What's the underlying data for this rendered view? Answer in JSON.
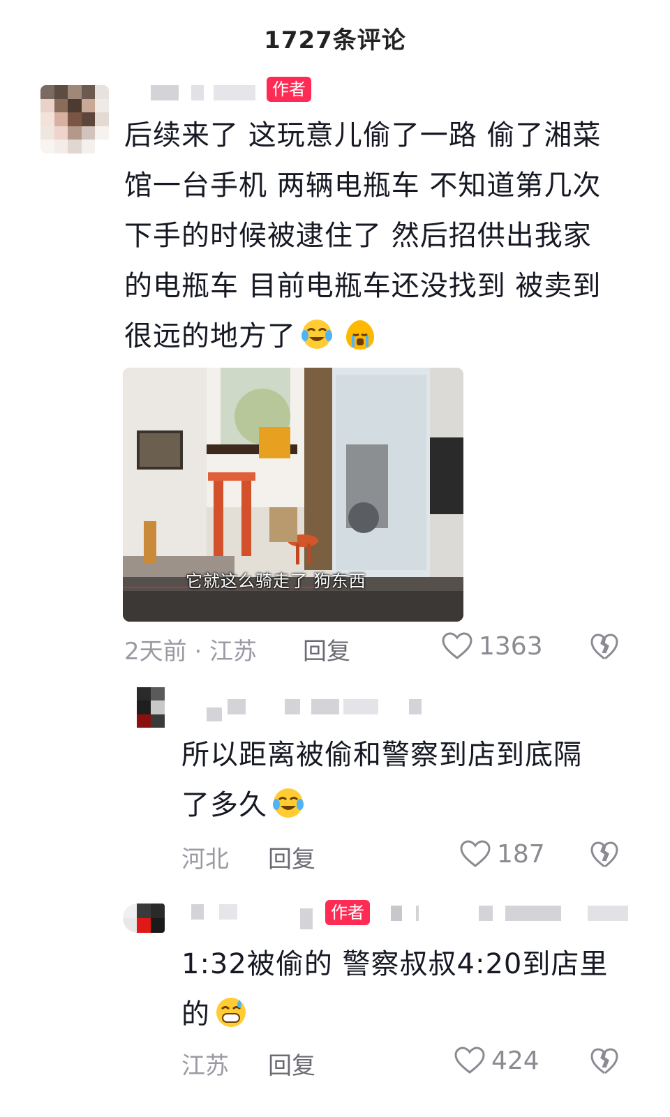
{
  "header": {
    "title": "1727条评论"
  },
  "comments": [
    {
      "author_tag": "作者",
      "text_lines": [
        "后续来了 这玩意儿偷了一路 偷了湘菜",
        "馆一台手机 两辆电瓶车 不知道第几次",
        "下手的时候被逮住了 然后招供出我家",
        "的电瓶车 目前电瓶车还没找到 被卖到",
        "很远的地方了"
      ],
      "video_subtitle": "它就这么骑走了 狗东西",
      "time_location": "2天前 · 江苏",
      "reply_label": "回复",
      "likes": "1363"
    }
  ],
  "replies": [
    {
      "text_lines": [
        "所以距离被偷和警察到店到底隔",
        "了多久"
      ],
      "location": "河北",
      "reply_label": "回复",
      "likes": "187"
    },
    {
      "author_tag": "作者",
      "text_lines": [
        "1:32被偷的 警察叔叔4:20到店里",
        "的"
      ],
      "location": "江苏",
      "reply_label": "回复",
      "likes": "424"
    }
  ],
  "icons": {
    "like": "heart-outline-icon",
    "dislike": "broken-heart-icon",
    "emoji_joy": "tears-of-joy-emoji",
    "emoji_cry": "crying-face-emoji",
    "emoji_sweat": "grinning-sweat-emoji"
  },
  "colors": {
    "author_tag": "#fe2c55",
    "meta_text": "#9a9aa3",
    "body_text": "#161823"
  }
}
